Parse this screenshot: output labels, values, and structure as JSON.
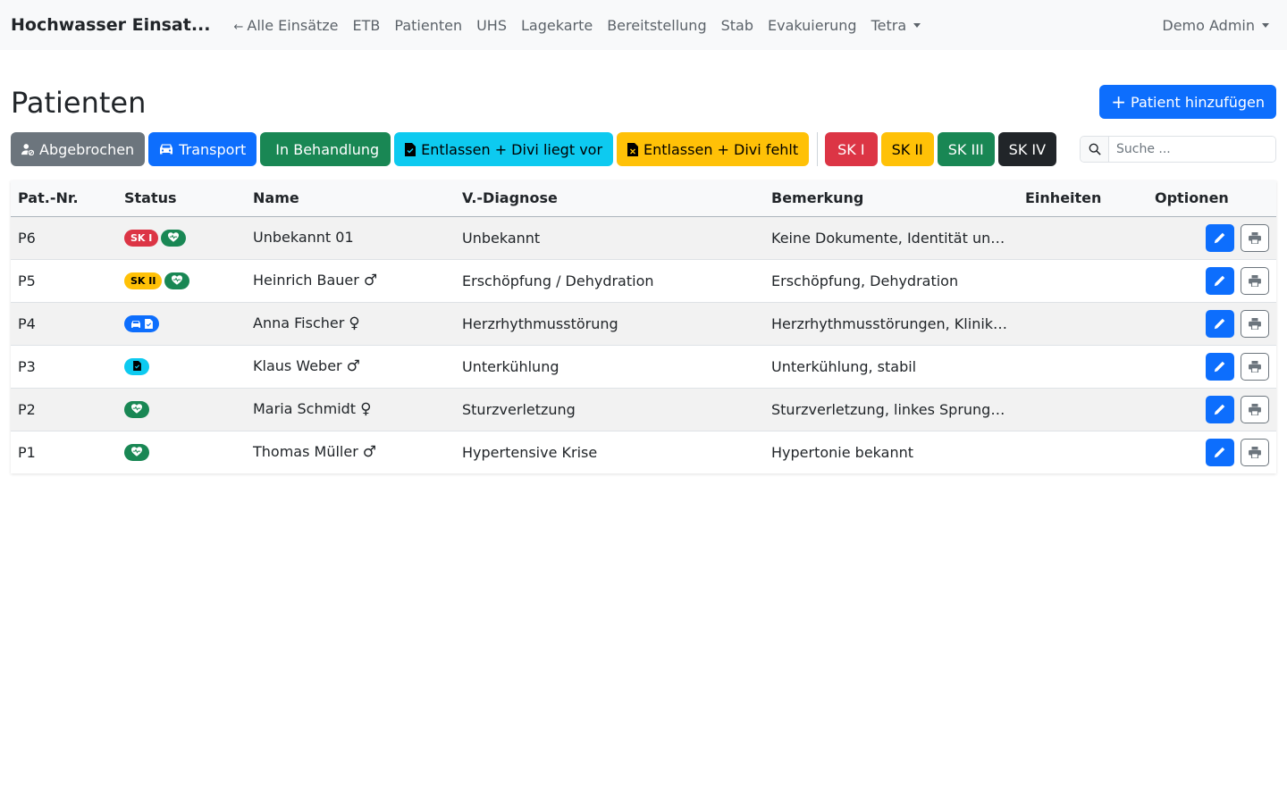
{
  "nav": {
    "brand": "Hochwasser Einsat...",
    "back_link": "Alle Einsätze",
    "links": [
      "ETB",
      "Patienten",
      "UHS",
      "Lagekarte",
      "Bereitstellung",
      "Stab",
      "Evakuierung",
      "Tetra"
    ],
    "user": "Demo Admin"
  },
  "page": {
    "title": "Patienten",
    "add_button": "Patient hinzufügen"
  },
  "filters": {
    "status": [
      "Abgebrochen",
      "Transport",
      "In Behandlung",
      "Entlassen + Divi liegt vor",
      "Entlassen + Divi fehlt"
    ],
    "triage": [
      "SK I",
      "SK II",
      "SK III",
      "SK IV"
    ],
    "search_placeholder": "Suche ..."
  },
  "colors": {
    "primary": "#0d6efd",
    "secondary": "#6c757d",
    "success": "#198754",
    "info": "#0dcaf0",
    "warning": "#ffc107",
    "danger": "#dc3545",
    "dark": "#212529"
  },
  "table": {
    "headers": [
      "Pat.-Nr.",
      "Status",
      "Name",
      "V.-Diagnose",
      "Bemerkung",
      "Einheiten",
      "Optionen"
    ],
    "rows": [
      {
        "id": "P6",
        "triage": "SK I",
        "status_icons": [
          "heart-pulse-icon"
        ],
        "name": "Unbekannt 01",
        "gender": "",
        "diagnose": "Unbekannt",
        "bemerkung": "Keine Dokumente, Identität unge...",
        "einheiten": ""
      },
      {
        "id": "P5",
        "triage": "SK II",
        "status_icons": [
          "heart-pulse-icon"
        ],
        "name": "Heinrich Bauer",
        "gender": "♂",
        "diagnose": "Erschöpfung / Dehydration",
        "bemerkung": "Erschöpfung, Dehydration",
        "einheiten": ""
      },
      {
        "id": "P4",
        "triage": "",
        "status_icons": [
          "car-icon",
          "document-check-icon"
        ],
        "name": "Anna Fischer",
        "gender": "♀",
        "diagnose": "Herzrhythmusstörung",
        "bemerkung": "Herzrhythmusstörungen, Klinik-Tr...",
        "einheiten": ""
      },
      {
        "id": "P3",
        "triage": "",
        "status_icons": [
          "document-check-icon"
        ],
        "name": "Klaus Weber",
        "gender": "♂",
        "diagnose": "Unterkühlung",
        "bemerkung": "Unterkühlung, stabil",
        "einheiten": ""
      },
      {
        "id": "P2",
        "triage": "",
        "status_icons": [
          "heart-pulse-icon"
        ],
        "name": "Maria Schmidt",
        "gender": "♀",
        "diagnose": "Sturzverletzung",
        "bemerkung": "Sturzverletzung, linkes Sprunggel...",
        "einheiten": ""
      },
      {
        "id": "P1",
        "triage": "",
        "status_icons": [
          "heart-pulse-icon"
        ],
        "name": "Thomas Müller",
        "gender": "♂",
        "diagnose": "Hypertensive Krise",
        "bemerkung": "Hypertonie bekannt",
        "einheiten": ""
      }
    ]
  }
}
